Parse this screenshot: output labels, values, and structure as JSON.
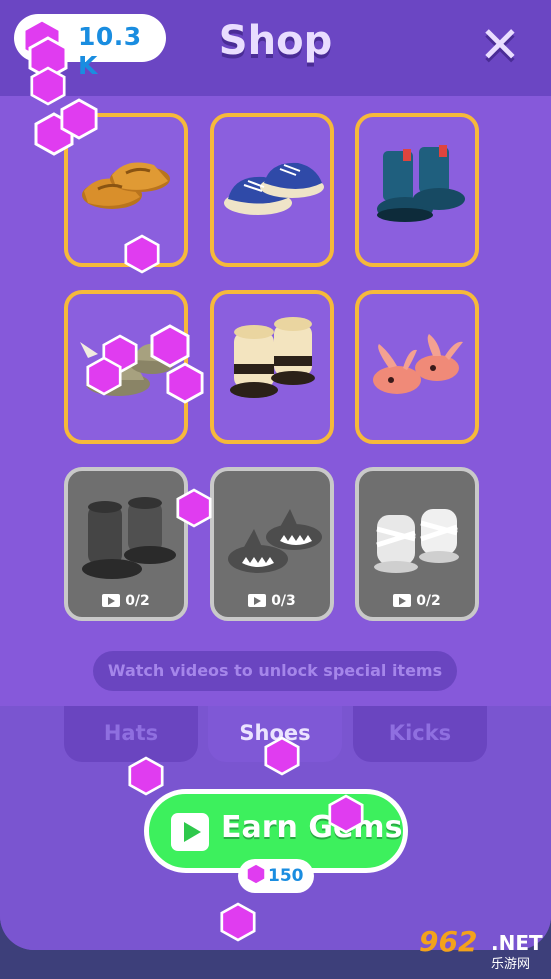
{
  "header": {
    "currency": "10.3 K",
    "title": "Shop",
    "close_icon": "close-x-icon"
  },
  "items": [
    {
      "name": "brown-loafers",
      "state": "owned"
    },
    {
      "name": "blue-sneakers",
      "state": "owned"
    },
    {
      "name": "blue-boots",
      "state": "owned"
    },
    {
      "name": "spiked-shoes",
      "state": "owned"
    },
    {
      "name": "cream-sandal-boots",
      "state": "owned"
    },
    {
      "name": "pink-bunny-slippers",
      "state": "owned"
    },
    {
      "name": "black-boots",
      "state": "locked",
      "progress": "0/2"
    },
    {
      "name": "shark-slippers",
      "state": "locked",
      "progress": "0/3"
    },
    {
      "name": "white-strap-shoes",
      "state": "locked",
      "progress": "0/2"
    }
  ],
  "hint": "Watch videos to unlock special items",
  "tabs": [
    {
      "label": "Hats",
      "active": false
    },
    {
      "label": "Shoes",
      "active": true
    },
    {
      "label": "Kicks",
      "active": false
    }
  ],
  "earn_button": {
    "label": "Earn Gems",
    "reward": "150"
  },
  "watermark": {
    "number": "962",
    "suffix": ".NET",
    "site": "乐游网"
  },
  "colors": {
    "panel": "#7a55d0",
    "owned_border": "#f6b93b",
    "earn_green": "#3df05d",
    "gem": "#e03cf0"
  }
}
